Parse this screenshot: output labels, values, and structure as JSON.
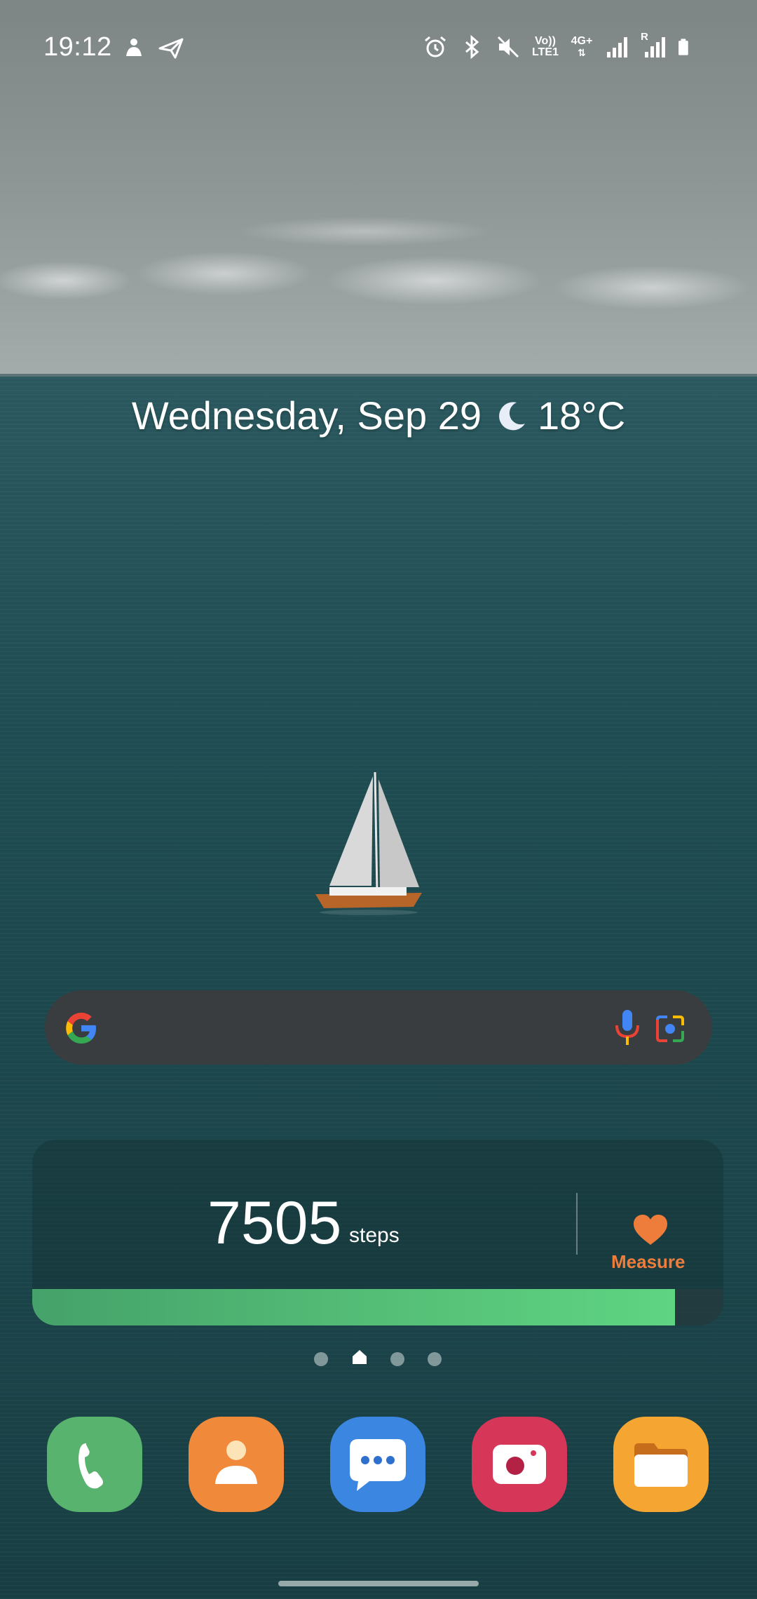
{
  "status_bar": {
    "time": "19:12",
    "left_icons": [
      "person-notification-icon",
      "send-notification-icon"
    ],
    "right_icons": [
      "alarm-icon",
      "bluetooth-icon",
      "mute-icon",
      "volte-icon",
      "network-4g-icon",
      "signal-icon",
      "signal-roaming-icon",
      "battery-icon"
    ],
    "volte_label": "Vo)) LTE1",
    "network_label": "4G+",
    "roaming_label": "R"
  },
  "date_widget": {
    "date": "Wednesday, Sep 29",
    "weather_icon": "moon-icon",
    "temperature": "18°C"
  },
  "search": {
    "logo": "google-icon",
    "mic_icon": "mic-icon",
    "lens_icon": "lens-camera-icon"
  },
  "steps_widget": {
    "count": "7505",
    "unit": "steps",
    "measure_label": "Measure",
    "progress": 0.93,
    "colors": {
      "accent": "#ee7d3c",
      "progress": "#5fd482"
    }
  },
  "page_indicator": {
    "pages": 4,
    "current": 1
  },
  "dock": {
    "apps": [
      {
        "name": "Phone",
        "icon": "phone-icon",
        "color": "#58b36e"
      },
      {
        "name": "Contacts",
        "icon": "contacts-icon",
        "color": "#f08a3a"
      },
      {
        "name": "Messages",
        "icon": "messages-icon",
        "color": "#3b86e0"
      },
      {
        "name": "Camera",
        "icon": "camera-icon",
        "color": "#d63657"
      },
      {
        "name": "My Files",
        "icon": "folder-icon",
        "color": "#f5a531"
      }
    ]
  }
}
